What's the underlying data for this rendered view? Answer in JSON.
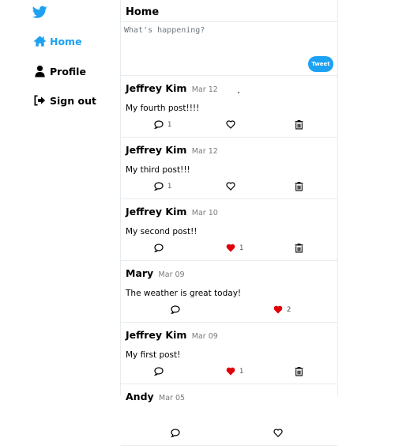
{
  "colors": {
    "accent": "#1da1f2",
    "liked": "#e0000a"
  },
  "nav": {
    "home": "Home",
    "profile": "Profile",
    "signout": "Sign out"
  },
  "header": {
    "title": "Home"
  },
  "compose": {
    "placeholder": "What's happening?",
    "button": "Tweet"
  },
  "posts": [
    {
      "author": "Jeffrey Kim",
      "date": "Mar 12",
      "body": "My fourth post!!!!",
      "comments": "1",
      "likes": "",
      "liked": false,
      "deletable": true
    },
    {
      "author": "Jeffrey Kim",
      "date": "Mar 12",
      "body": "My third post!!!",
      "comments": "1",
      "likes": "",
      "liked": false,
      "deletable": true
    },
    {
      "author": "Jeffrey Kim",
      "date": "Mar 10",
      "body": "My second post!!",
      "comments": "",
      "likes": "1",
      "liked": true,
      "deletable": true
    },
    {
      "author": "Mary",
      "date": "Mar 09",
      "body": "The weather is great today!",
      "comments": "",
      "likes": "2",
      "liked": true,
      "deletable": false
    },
    {
      "author": "Jeffrey Kim",
      "date": "Mar 09",
      "body": "My first post!",
      "comments": "",
      "likes": "1",
      "liked": true,
      "deletable": true
    },
    {
      "author": "Andy",
      "date": "Mar 05",
      "body": "",
      "comments": "",
      "likes": "",
      "liked": false,
      "deletable": false
    }
  ]
}
